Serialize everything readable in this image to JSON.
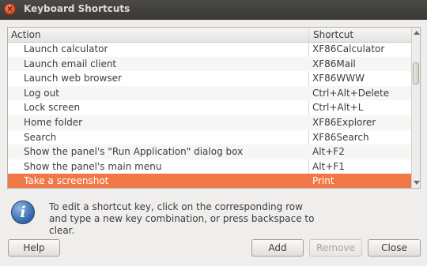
{
  "window": {
    "title": "Keyboard Shortcuts",
    "close_glyph": "×"
  },
  "table": {
    "columns": {
      "action": "Action",
      "shortcut": "Shortcut"
    },
    "rows": [
      {
        "action": "Launch calculator",
        "shortcut": "XF86Calculator"
      },
      {
        "action": "Launch email client",
        "shortcut": "XF86Mail"
      },
      {
        "action": "Launch web browser",
        "shortcut": "XF86WWW"
      },
      {
        "action": "Log out",
        "shortcut": "Ctrl+Alt+Delete"
      },
      {
        "action": "Lock screen",
        "shortcut": "Ctrl+Alt+L"
      },
      {
        "action": "Home folder",
        "shortcut": "XF86Explorer"
      },
      {
        "action": "Search",
        "shortcut": "XF86Search"
      },
      {
        "action": "Show the panel's \"Run Application\" dialog box",
        "shortcut": "Alt+F2"
      },
      {
        "action": "Show the panel's main menu",
        "shortcut": "Alt+F1"
      },
      {
        "action": "Take a screenshot",
        "shortcut": "Print",
        "selected": true
      }
    ]
  },
  "info": {
    "icon": "info-icon",
    "icon_glyph": "i",
    "text": "To edit a shortcut key, click on the corresponding row and type a new key combination, or press backspace to clear."
  },
  "buttons": {
    "help": "Help",
    "add": "Add",
    "remove": "Remove",
    "close": "Close"
  },
  "colors": {
    "selection": "#f07746",
    "titlebar": "#3f3e3a"
  }
}
